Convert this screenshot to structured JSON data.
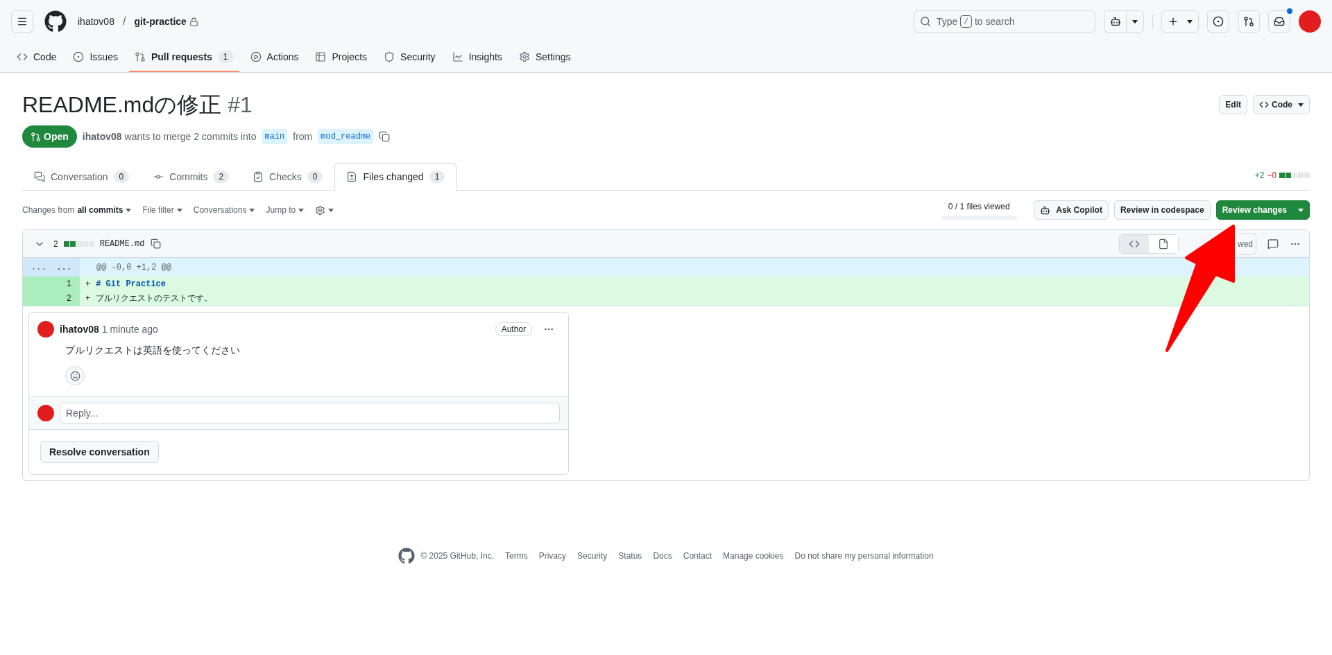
{
  "header": {
    "owner": "ihatov08",
    "separator": "/",
    "repo": "git-practice",
    "search": {
      "before": "Type",
      "key": "/",
      "after": "to search"
    },
    "notification_unread": true
  },
  "repo_nav": [
    {
      "label": "Code",
      "selected": false
    },
    {
      "label": "Issues",
      "selected": false
    },
    {
      "label": "Pull requests",
      "count": "1",
      "selected": true
    },
    {
      "label": "Actions",
      "selected": false
    },
    {
      "label": "Projects",
      "selected": false
    },
    {
      "label": "Security",
      "selected": false
    },
    {
      "label": "Insights",
      "selected": false
    },
    {
      "label": "Settings",
      "selected": false
    }
  ],
  "pull_request": {
    "title": "README.mdの修正",
    "number": "#1",
    "state": "Open",
    "author": "ihatov08",
    "summary": "wants to merge 2 commits into",
    "base": "main",
    "from": "from",
    "head": "mod_readme",
    "actions": [
      "Edit",
      "Code"
    ]
  },
  "pr_tabs": [
    {
      "label": "Conversation",
      "count": "0",
      "selected": false
    },
    {
      "label": "Commits",
      "count": "2",
      "selected": false
    },
    {
      "label": "Checks",
      "count": "0",
      "selected": false
    },
    {
      "label": "Files changed",
      "count": "1",
      "selected": true
    }
  ],
  "diffstat": {
    "additions": "+2",
    "deletions": "−0",
    "level": 0.4
  },
  "toolbar": {
    "filters": [
      {
        "prefix": "Changes from",
        "label": "all commits"
      },
      {
        "label": "File filter"
      },
      {
        "label": "Conversations"
      },
      {
        "label": "Jump to"
      }
    ],
    "files_viewed": {
      "text": "0 / 1 files viewed",
      "level": 0
    },
    "buttons": [
      {
        "label": "Ask Copilot",
        "kind": "copilot"
      },
      {
        "label": "Review in codespace",
        "kind": "default"
      },
      {
        "label": "Review changes",
        "kind": "primary"
      }
    ]
  },
  "file": {
    "changes": "2",
    "level": 0.4,
    "name": "README.md",
    "view": [
      {
        "selected": true
      },
      {
        "selected": false
      }
    ],
    "viewed_text": "wed",
    "lines": [
      {
        "kind": "hunk",
        "old": "...",
        "new": "...",
        "text": "@@ -0,0 +1,2 @@"
      },
      {
        "kind": "added",
        "new": "1",
        "sign": "+",
        "text": "# Git Practice",
        "heading": true
      },
      {
        "kind": "added",
        "new": "2",
        "sign": "+",
        "text": "プルリクエストのテストです。",
        "heading": false
      }
    ]
  },
  "comment": {
    "author": "ihatov08",
    "time": "1 minute ago",
    "badge": "Author",
    "body": "プルリクエストは英語を使ってください",
    "reply_placeholder": "Reply...",
    "resolve": "Resolve conversation"
  },
  "footer": {
    "copyright": "© 2025 GitHub, Inc.",
    "links": [
      "Terms",
      "Privacy",
      "Security",
      "Status",
      "Docs",
      "Contact",
      "Manage cookies",
      "Do not share my personal information"
    ]
  }
}
